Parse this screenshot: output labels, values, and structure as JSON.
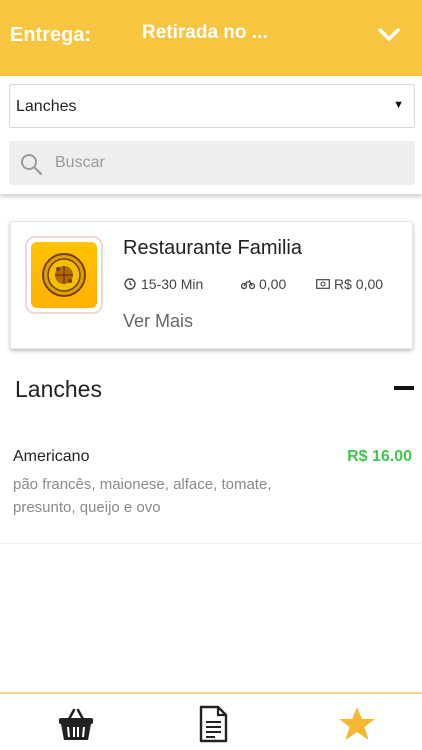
{
  "header": {
    "delivery_label": "Entrega:",
    "delivery_value": "Retirada no ...",
    "accent_color": "#f8c540"
  },
  "category_select": {
    "selected": "Lanches"
  },
  "search": {
    "placeholder": "Buscar"
  },
  "restaurant": {
    "name": "Restaurante Familia",
    "delivery_time": "15-30 Min",
    "delivery_fee": "0,00",
    "minimum_order": "R$ 0,00",
    "more_label": "Ver Mais"
  },
  "menu": {
    "category_title": "Lanches",
    "items": [
      {
        "name": "Americano",
        "price": "R$ 16.00",
        "description": "pão francês, maionese, alface, tomate, presunto, queijo e ovo"
      }
    ]
  },
  "bottom_nav": {
    "icons": [
      "basket-icon",
      "document-icon",
      "star-icon"
    ],
    "star_color": "#f8b731"
  }
}
